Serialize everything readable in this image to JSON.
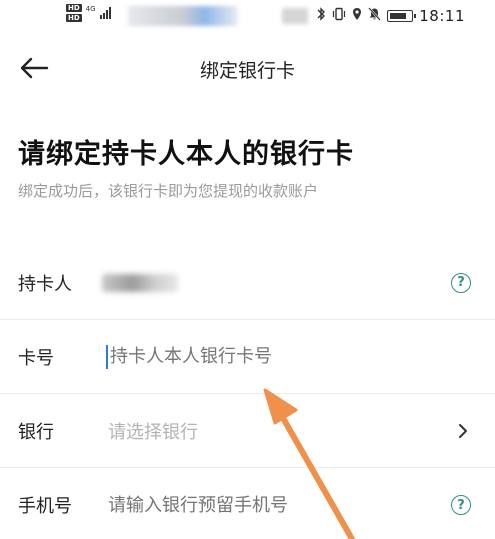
{
  "status_bar": {
    "hd_1": "HD",
    "hd_2": "HD",
    "network": "4G",
    "time": "18:11",
    "icons": [
      "bluetooth-icon",
      "vibrate-icon",
      "location-icon",
      "mute-icon",
      "battery-icon"
    ]
  },
  "nav": {
    "title": "绑定银行卡",
    "back_icon": "arrow-left-icon"
  },
  "header": {
    "heading": "请绑定持卡人本人的银行卡",
    "subtitle": "绑定成功后，该银行卡即为您提现的收款账户"
  },
  "form": {
    "cardholder": {
      "label": "持卡人",
      "help_icon": "help-circle-icon",
      "help_glyph": "?"
    },
    "card_number": {
      "label": "卡号",
      "placeholder": "持卡人本人银行卡号"
    },
    "bank": {
      "label": "银行",
      "placeholder": "请选择银行",
      "chevron_icon": "chevron-right-icon"
    },
    "phone": {
      "label": "手机号",
      "placeholder": "请输入银行预留手机号",
      "help_icon": "help-circle-icon",
      "help_glyph": "?"
    }
  },
  "colors": {
    "accent": "#2f8f86",
    "cursor": "#2a7de1",
    "annotation_arrow": "#f0904a",
    "placeholder": "#b3b3b3",
    "subtitle": "#9a9a9a"
  }
}
